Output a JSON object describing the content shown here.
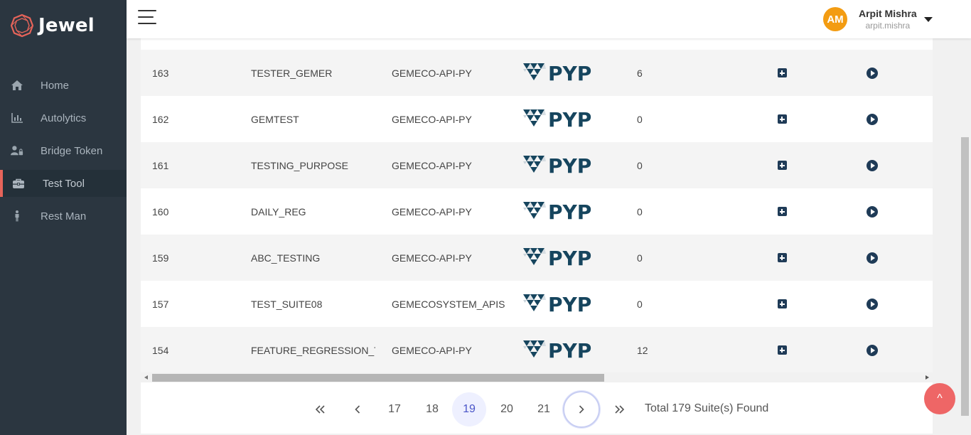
{
  "app": {
    "brand": "Jewel"
  },
  "sidebar": {
    "items": [
      {
        "label": "Home",
        "icon": "home-icon"
      },
      {
        "label": "Autolytics",
        "icon": "bar-chart-icon"
      },
      {
        "label": "Bridge Token",
        "icon": "user-lock-icon"
      },
      {
        "label": "Test Tool",
        "icon": "toolbox-icon",
        "active": true
      },
      {
        "label": "Rest Man",
        "icon": "person-walking-icon"
      }
    ]
  },
  "header": {
    "user": {
      "initials": "AM",
      "name": "Arpit Mishra",
      "handle": "arpit.mishra"
    }
  },
  "table": {
    "rows": [
      {
        "id": "163",
        "name": "TESTER_GEMER",
        "project": "GEMECO-API-PY",
        "logo": "PYP",
        "count": "6"
      },
      {
        "id": "162",
        "name": "GEMTEST",
        "project": "GEMECO-API-PY",
        "logo": "PYP",
        "count": "0"
      },
      {
        "id": "161",
        "name": "TESTING_PURPOSE",
        "project": "GEMECO-API-PY",
        "logo": "PYP",
        "count": "0"
      },
      {
        "id": "160",
        "name": "DAILY_REG",
        "project": "GEMECO-API-PY",
        "logo": "PYP",
        "count": "0"
      },
      {
        "id": "159",
        "name": "ABC_TESTING",
        "project": "GEMECO-API-PY",
        "logo": "PYP",
        "count": "0"
      },
      {
        "id": "157",
        "name": "TEST_SUITE08",
        "project": "GEMECOSYSTEM_APIS",
        "logo": "PYP",
        "count": "0"
      },
      {
        "id": "154",
        "name": "FEATURE_REGRESSION_T",
        "project": "GEMECO-API-PY",
        "logo": "PYP",
        "count": "12"
      }
    ]
  },
  "pagination": {
    "pages": [
      "17",
      "18",
      "19",
      "20",
      "21"
    ],
    "current": "19",
    "total_text": "Total 179 Suite(s) Found"
  },
  "back_to_top": "^",
  "colors": {
    "sidebar_bg": "#2b3640",
    "accent": "#e6645a",
    "avatar": "#f39c12",
    "action": "#1f3b57",
    "pyp_logo": "#16455e"
  }
}
